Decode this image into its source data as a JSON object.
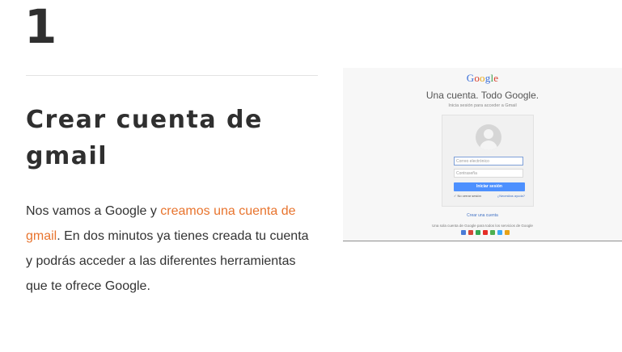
{
  "step": {
    "number": "1"
  },
  "section": {
    "title": "Crear cuenta de gmail",
    "text_before_link": "Nos vamos a Google y ",
    "link_text": "creamos una cuenta de gmail",
    "text_after_link": ". En dos minutos ya tienes creada tu cuenta y podrás acceder a las diferentes herramientas que te ofrece Google."
  },
  "screenshot": {
    "logo_letters": [
      "G",
      "o",
      "o",
      "g",
      "l",
      "e"
    ],
    "tagline": "Una cuenta. Todo Google.",
    "subtitle": "Inicia sesión para acceder a Gmail",
    "email_placeholder": "Correo electrónico",
    "password_placeholder": "Contraseña",
    "login_button": "Iniciar sesión",
    "stay_signed_in": "✓ No cerrar sesión",
    "need_help": "¿Necesitas ayuda?",
    "create_account": "Crear una cuenta",
    "one_account_text": "Una sola cuenta de Google para todos los servicios de Google",
    "service_icons": [
      {
        "name": "google-icon",
        "color": "#4a7bd6"
      },
      {
        "name": "gmail-icon",
        "color": "#d44638"
      },
      {
        "name": "drive-icon",
        "color": "#34a853"
      },
      {
        "name": "youtube-icon",
        "color": "#e52d27"
      },
      {
        "name": "maps-icon",
        "color": "#4caf50"
      },
      {
        "name": "play-icon",
        "color": "#3fa9f5"
      },
      {
        "name": "chrome-icon",
        "color": "#e8a317"
      }
    ]
  },
  "colors": {
    "link": "#e8742e",
    "heading": "#2f2f2f"
  }
}
